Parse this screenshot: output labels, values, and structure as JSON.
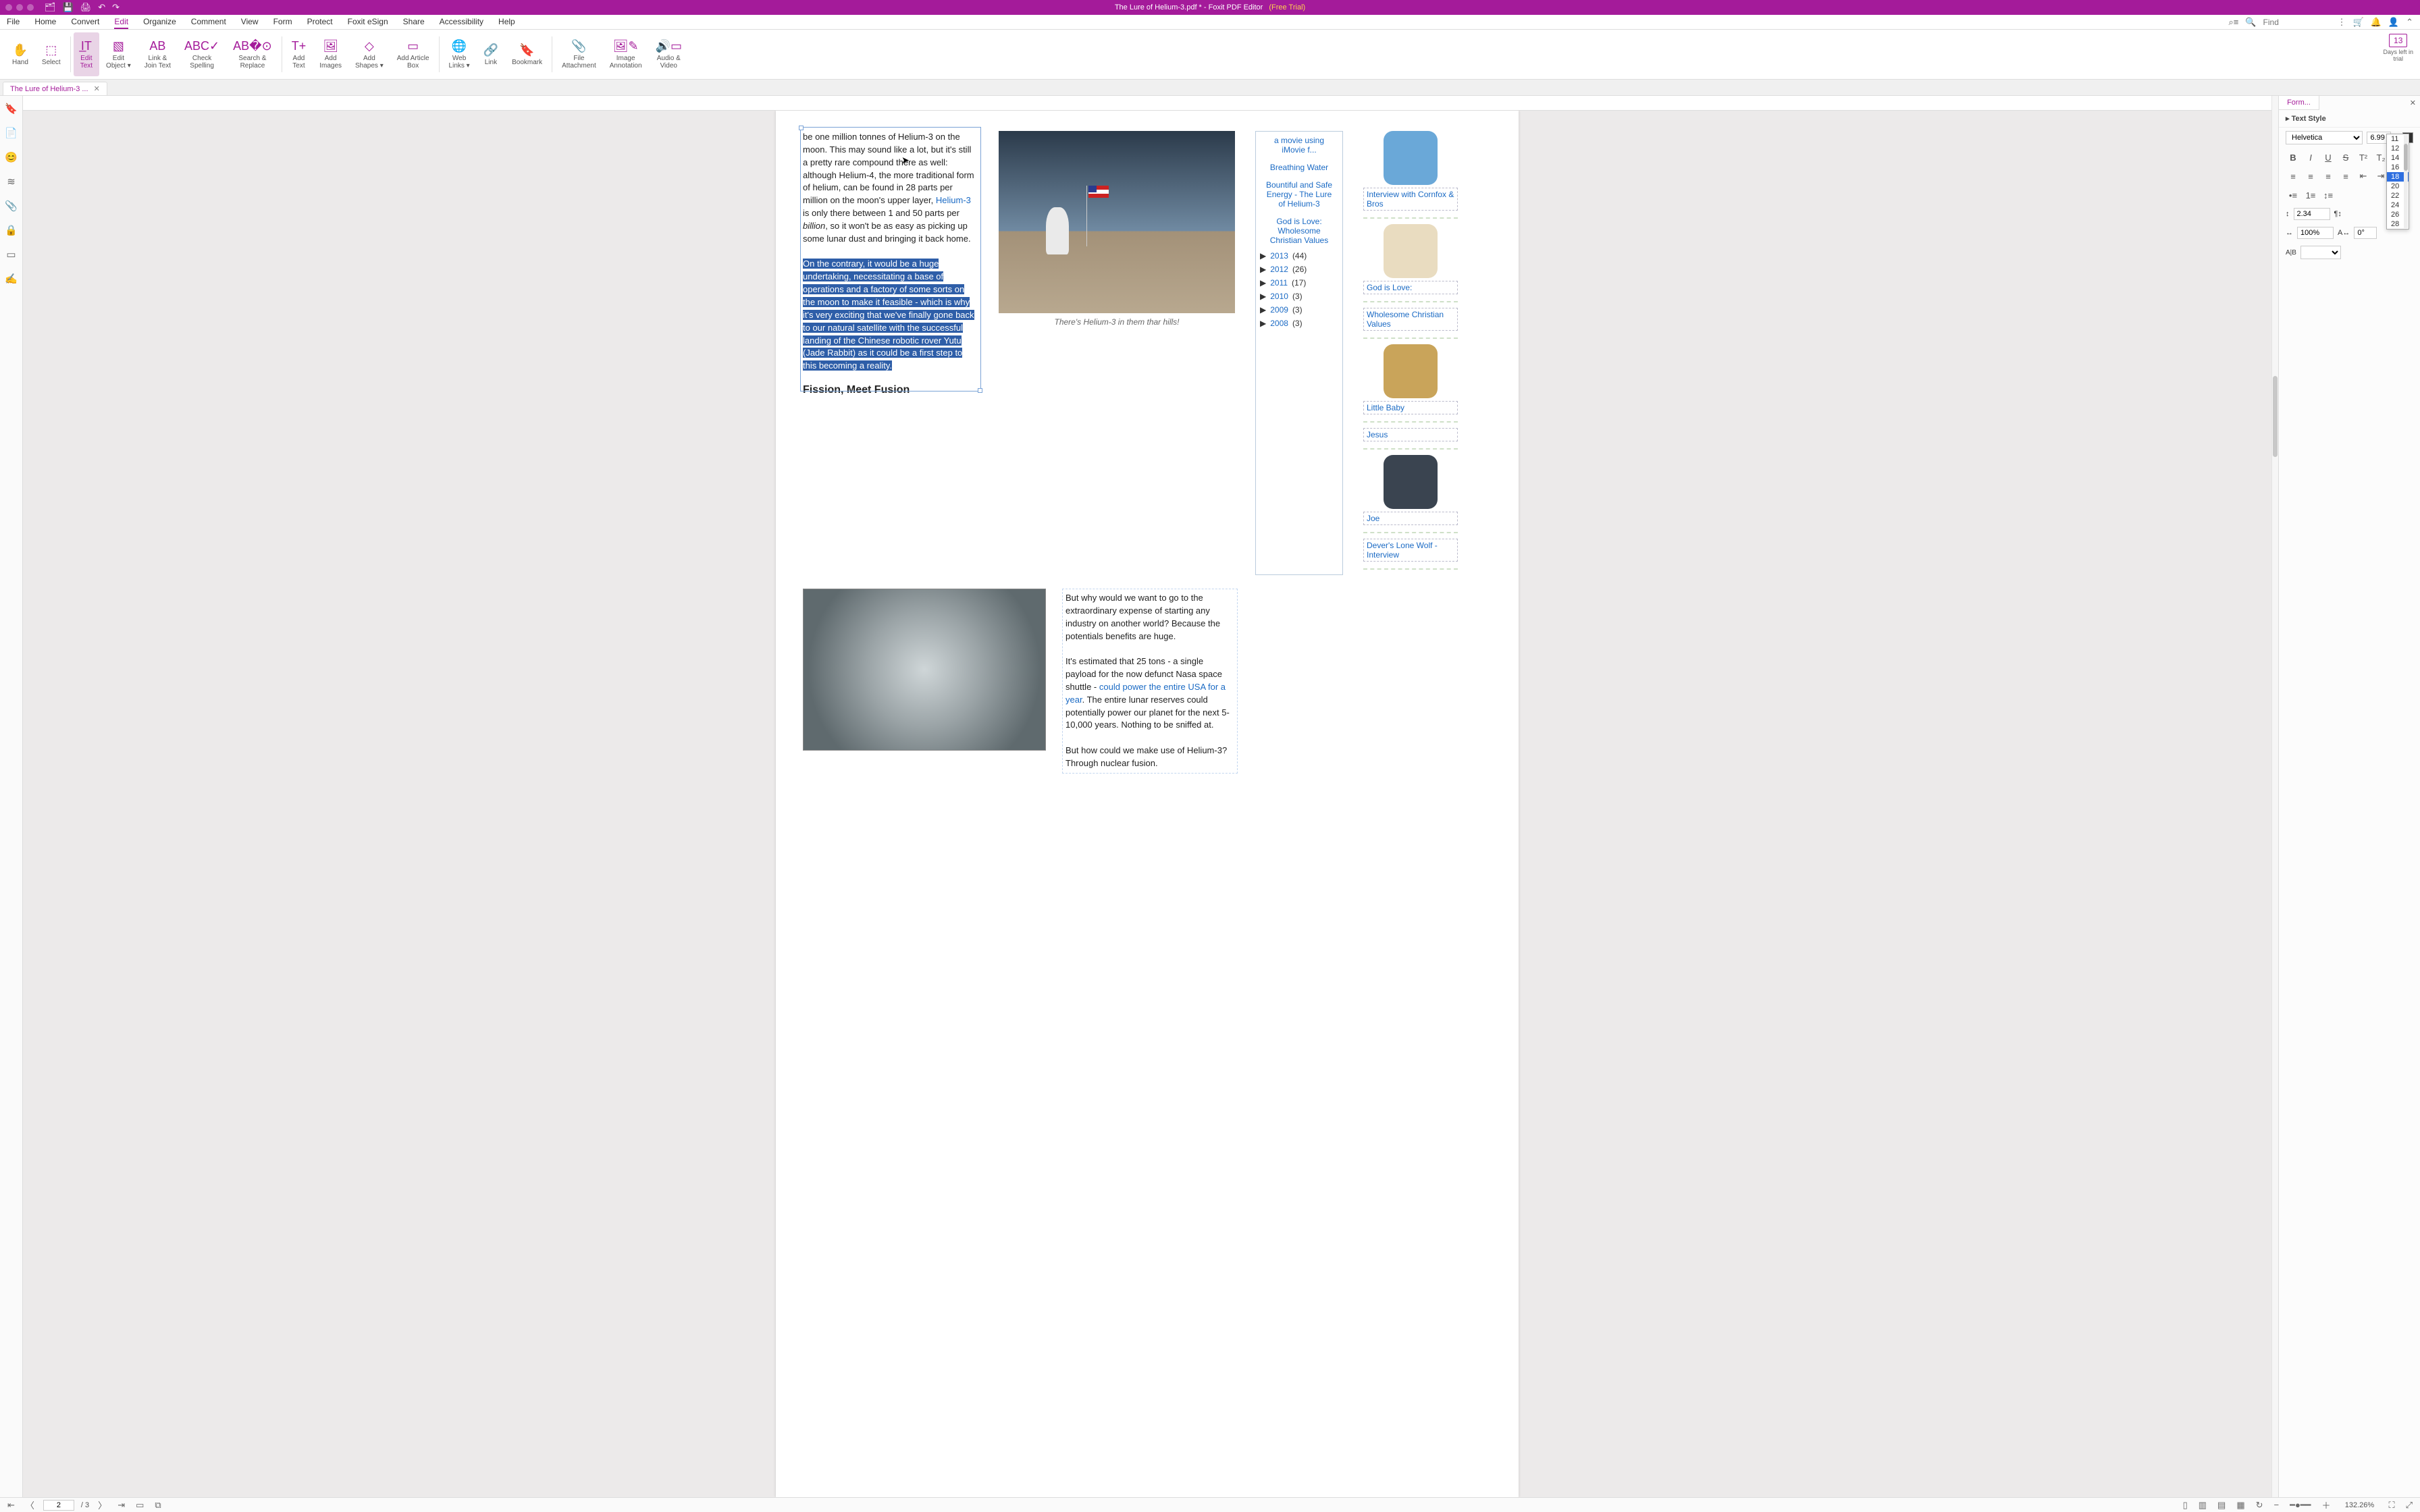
{
  "titlebar": {
    "filename": "The Lure of Helium-3.pdf *",
    "separator": " - ",
    "app": "Foxit PDF Editor",
    "trial": "(Free Trial)"
  },
  "menu": {
    "items": [
      "File",
      "Home",
      "Convert",
      "Edit",
      "Organize",
      "Comment",
      "View",
      "Form",
      "Protect",
      "Foxit eSign",
      "Share",
      "Accessibility",
      "Help"
    ],
    "active_index": 3,
    "find_placeholder": "Find"
  },
  "ribbon": {
    "tools": [
      {
        "icon": "✋",
        "label": "Hand"
      },
      {
        "icon": "⬚",
        "label": "Select"
      },
      {
        "sep": true
      },
      {
        "icon": "I̲T",
        "label": "Edit\nText",
        "active": true
      },
      {
        "icon": "▧",
        "label": "Edit\nObject ▾"
      },
      {
        "icon": "AB",
        "label": "Link &\nJoin Text"
      },
      {
        "icon": "ABC✓",
        "label": "Check\nSpelling"
      },
      {
        "icon": "AB�⊙",
        "label": "Search &\nReplace"
      },
      {
        "sep": true
      },
      {
        "icon": "T+",
        "label": "Add\nText"
      },
      {
        "icon": "🖼",
        "label": "Add\nImages"
      },
      {
        "icon": "◇",
        "label": "Add\nShapes ▾"
      },
      {
        "icon": "▭",
        "label": "Add Article\nBox"
      },
      {
        "sep": true
      },
      {
        "icon": "🌐",
        "label": "Web\nLinks ▾"
      },
      {
        "icon": "🔗",
        "label": "Link"
      },
      {
        "icon": "🔖",
        "label": "Bookmark"
      },
      {
        "sep": true
      },
      {
        "icon": "📎",
        "label": "File\nAttachment"
      },
      {
        "icon": "🖼✎",
        "label": "Image\nAnnotation"
      },
      {
        "icon": "🔊▭",
        "label": "Audio &\nVideo"
      }
    ],
    "trial_days": "13",
    "trial_label": "Days left in\ntrial"
  },
  "tabs": {
    "items": [
      {
        "label": "The Lure of Helium-3 ..."
      }
    ]
  },
  "leftnav": {
    "icons": [
      "🔖",
      "📄",
      "😊",
      "≋",
      "📎",
      "🔒",
      "▭",
      "✍"
    ]
  },
  "doc": {
    "para1_a": "be one million tonnes of Helium-3 on the moon. This may sound like a lot, but it's still a pretty rare compound there as well: although Helium-4, the more traditional form of helium, can be found in 28 parts per million on the moon's upper layer, ",
    "para1_link": "Helium-3",
    "para1_b": " is only there between 1 and 50 parts per ",
    "para1_billion": "billion",
    "para1_c": ", so it won't be as easy as picking up some lunar dust and bringing it back home.",
    "para2_hl": "On the contrary, it would be a huge undertaking, necessitating a base of operations and a factory of some sorts on the moon to make it feasible - which is why it's very exciting that we've finally gone back to our natural satellite with the successful landing of the Chinese robotic rover Yutu (Jade Rabbit) as it could be a first step to this becoming a reality.",
    "heading": "Fission, Meet Fusion",
    "fig_caption": "There's Helium-3 in them thar hills!",
    "sidebar": {
      "items": [
        "a movie using iMovie f...",
        "Breathing Water",
        "Bountiful and Safe Energy - The Lure of Helium-3",
        "God is Love: Wholesome Christian Values"
      ],
      "years": [
        {
          "y": "2013",
          "c": "(44)"
        },
        {
          "y": "2012",
          "c": "(26)"
        },
        {
          "y": "2011",
          "c": "(17)"
        },
        {
          "y": "2010",
          "c": "(3)"
        },
        {
          "y": "2009",
          "c": "(3)"
        },
        {
          "y": "2008",
          "c": "(3)"
        }
      ]
    },
    "articles": [
      {
        "title": "Interview with Cornfox & Bros",
        "bg": "#6aa8d8"
      },
      {
        "title": "God is Love:",
        "bg": "#e9dcc0"
      },
      {
        "title": "Wholesome Christian Values",
        "noimg": true
      },
      {
        "title": "Little Baby",
        "bg": "#c9a45a"
      },
      {
        "title": "Jesus",
        "noimg": true
      },
      {
        "title": "Joe",
        "bg": "#3a4450"
      },
      {
        "title": "Dever's Lone Wolf - Interview",
        "noimg": true
      }
    ],
    "col2": {
      "p1": "But why would we want to go to the extraordinary expense of starting any industry on another world? Because the potentials benefits are huge.",
      "p2a": "It's estimated that 25 tons - a single payload for the now defunct Nasa space shuttle - ",
      "p2link": "could power the entire USA for a year",
      "p2b": ". The entire lunar reserves could potentially power our planet for the next 5-10,000 years. Nothing to be sniffed at.",
      "p3": "But how could we make use of Helium-3? Through nuclear fusion."
    }
  },
  "format": {
    "tab": "Form...",
    "section": "Text Style",
    "font": "Helvetica",
    "size": "6.99",
    "color": "#333333",
    "size_options": [
      "11",
      "12",
      "14",
      "16",
      "18",
      "20",
      "22",
      "24",
      "26",
      "28"
    ],
    "size_selected_index": 4,
    "line_spacing": "2.34",
    "scale": "100%",
    "rotate": "0°"
  },
  "status": {
    "page_current": "2",
    "page_total": "3",
    "zoom": "132.26%"
  }
}
